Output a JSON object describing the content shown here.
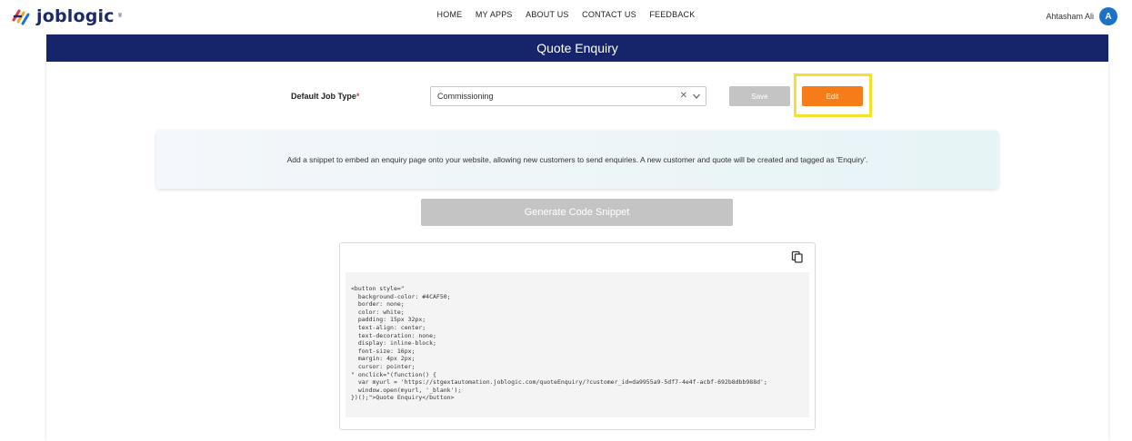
{
  "brand": {
    "name": "joblogic",
    "mark": "®"
  },
  "nav": [
    {
      "label": "HOME"
    },
    {
      "label": "MY APPS"
    },
    {
      "label": "ABOUT US"
    },
    {
      "label": "CONTACT US"
    },
    {
      "label": "FEEDBACK"
    }
  ],
  "user": {
    "name": "Ahtasham Ali",
    "initial": "A"
  },
  "page": {
    "title": "Quote Enquiry"
  },
  "form": {
    "job_type_label": "Default Job Type",
    "required_mark": "*",
    "job_type_value": "Commissioning",
    "clear_glyph": "✕",
    "save_label": "Save",
    "edit_label": "Edit"
  },
  "info_text": "Add a snippet to embed an enquiry page onto your website, allowing new customers to send enquiries. A new customer and quote will be created and tagged as 'Enquiry'.",
  "generate_label": "Generate Code Snippet",
  "code_snippet": "<button style=\"\n  background-color: #4CAF50;\n  border: none;\n  color: white;\n  padding: 15px 32px;\n  text-align: center;\n  text-decoration: none;\n  display: inline-block;\n  font-size: 16px;\n  margin: 4px 2px;\n  cursor: pointer;\n\" onclick=\"(function() {\n  var myurl = 'https://stgextautomation.joblogic.com/quoteEnquiry/?customer_id=da9955a9-5df7-4e4f-acbf-692b8dbb988d';\n  window.open(myurl, '_blank');\n})();\">Quote Enquiry</button>",
  "colors": {
    "header_bg": "#16256a",
    "edit_bg": "#f57c19",
    "disabled_bg": "#c4c4c4",
    "highlight": "#f5e12c",
    "avatar": "#1a73c8"
  },
  "icons": [
    "logo-icon",
    "clear-icon",
    "chevron-down-icon",
    "copy-icon"
  ]
}
